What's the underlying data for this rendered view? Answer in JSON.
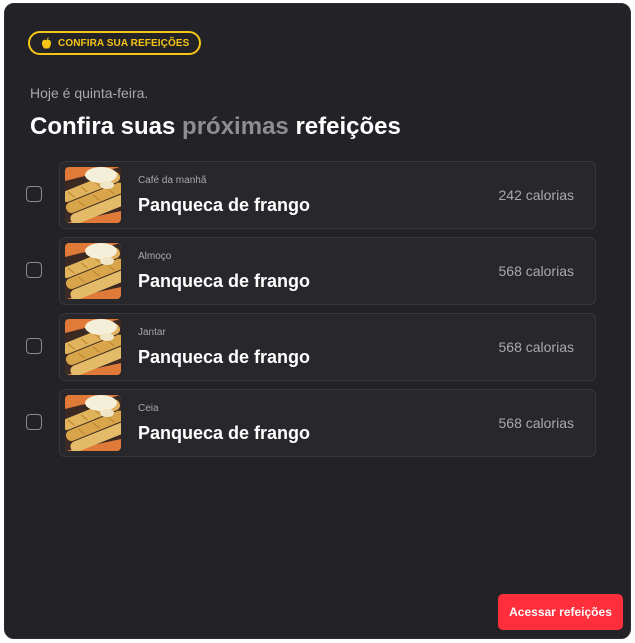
{
  "badge": {
    "label": "CONFIRA SUA REFEIÇÕES",
    "icon": "apple-icon",
    "color": "#f5c518"
  },
  "header": {
    "subtitle": "Hoje é quinta-feira.",
    "title_before": "Confira suas",
    "title_highlight": "próximas",
    "title_after": "refeições"
  },
  "meals": [
    {
      "label": "Café da manhã",
      "name": "Panqueca de frango",
      "calories": "242 calorias",
      "checked": false
    },
    {
      "label": "Almoço",
      "name": "Panqueca de frango",
      "calories": "568 calorias",
      "checked": false
    },
    {
      "label": "Jantar",
      "name": "Panqueca de frango",
      "calories": "568 calorias",
      "checked": false
    },
    {
      "label": "Ceia",
      "name": "Panqueca de frango",
      "calories": "568 calorias",
      "checked": false
    }
  ],
  "cta": {
    "label": "Acessar refeições",
    "color": "#ff2e3b"
  }
}
